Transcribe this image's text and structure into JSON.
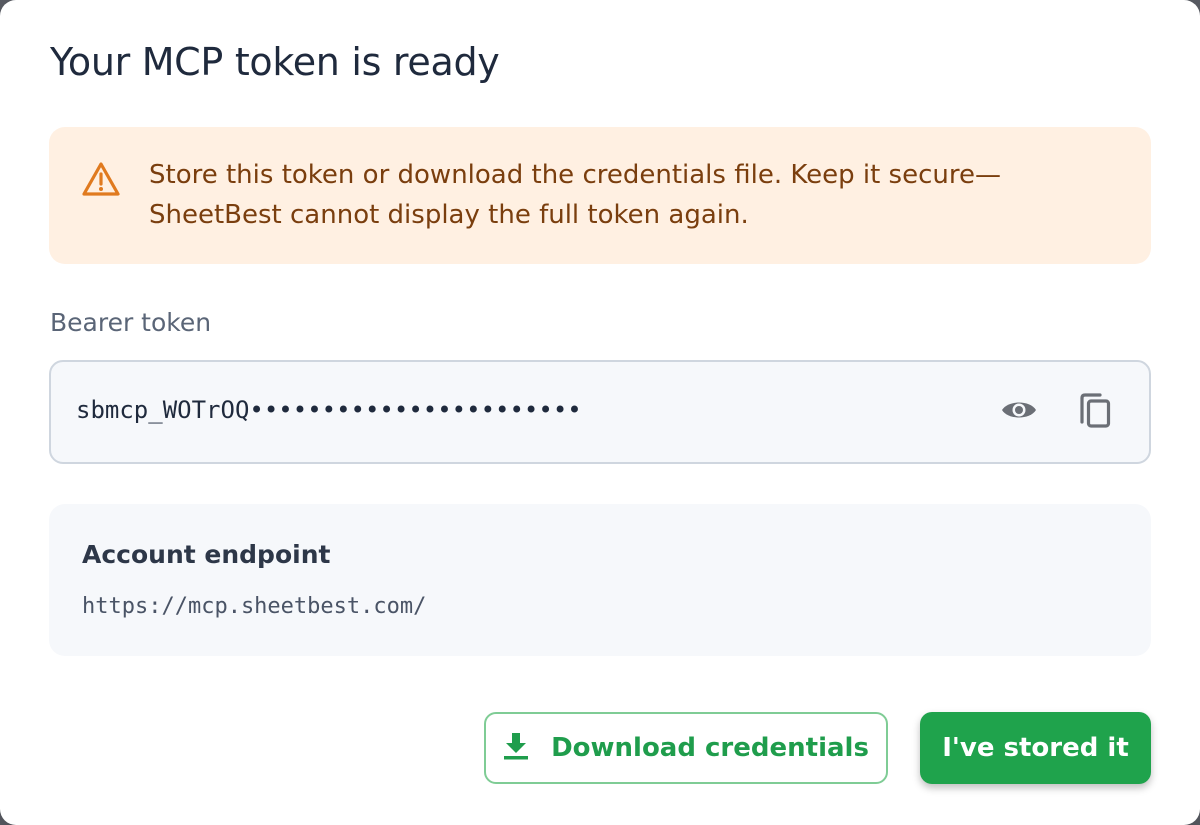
{
  "dialog": {
    "title": "Your MCP token is ready"
  },
  "warning": {
    "icon": "warning-triangle-icon",
    "line1": "Store this token or download the credentials file. Keep it secure—",
    "line2": "SheetBest cannot display the full token again.",
    "accent_color": "#e07a1f"
  },
  "token": {
    "label": "Bearer token",
    "masked_value": "sbmcp_WOTrOQ•••••••••••••••••••••••",
    "reveal_icon": "eye-icon",
    "copy_icon": "copy-icon"
  },
  "endpoint": {
    "title": "Account endpoint",
    "url": "https://mcp.sheetbest.com/"
  },
  "actions": {
    "download_label": "Download credentials",
    "download_icon": "download-icon",
    "confirm_label": "I've stored it",
    "primary_color": "#1fa34c"
  }
}
